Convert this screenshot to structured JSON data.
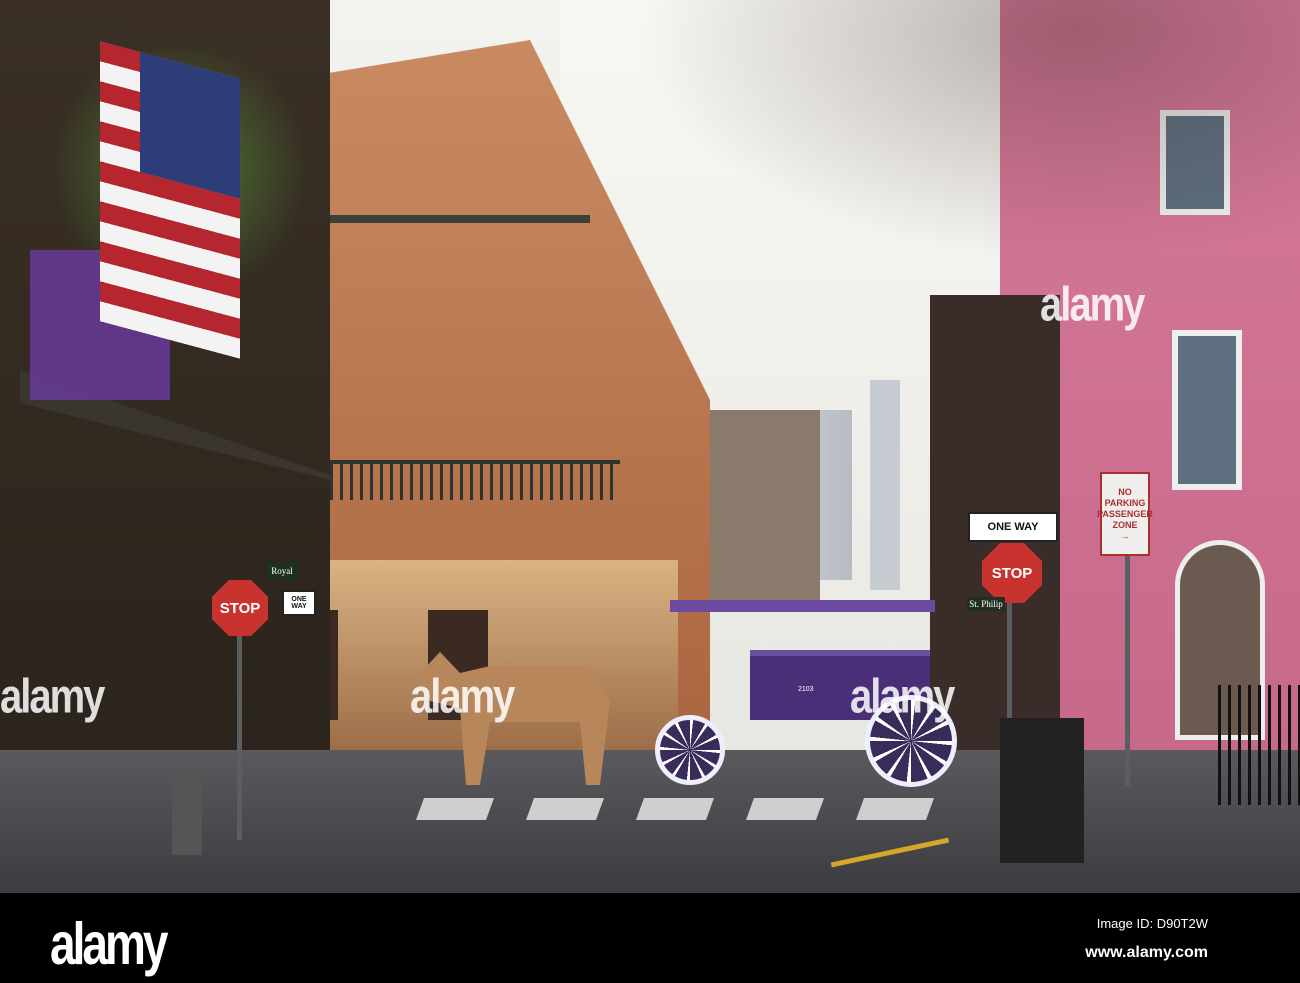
{
  "photo": {
    "signs": {
      "stop_left": "STOP",
      "stop_right": "STOP",
      "one_way_left": "ONE WAY",
      "one_way_right": "ONE WAY",
      "royal_street": "Royal",
      "st_philip_street": "St. Philip",
      "no_parking": "NO PARKING",
      "passenger_zone": "PASSENGER ZONE",
      "arrow": "→",
      "carriage_number": "2103"
    },
    "watermarks": [
      "alamy",
      "alamy",
      "alamy",
      "alamy"
    ]
  },
  "footer": {
    "logo": "alamy",
    "image_id": "Image ID: D90T2W",
    "url": "www.alamy.com"
  }
}
